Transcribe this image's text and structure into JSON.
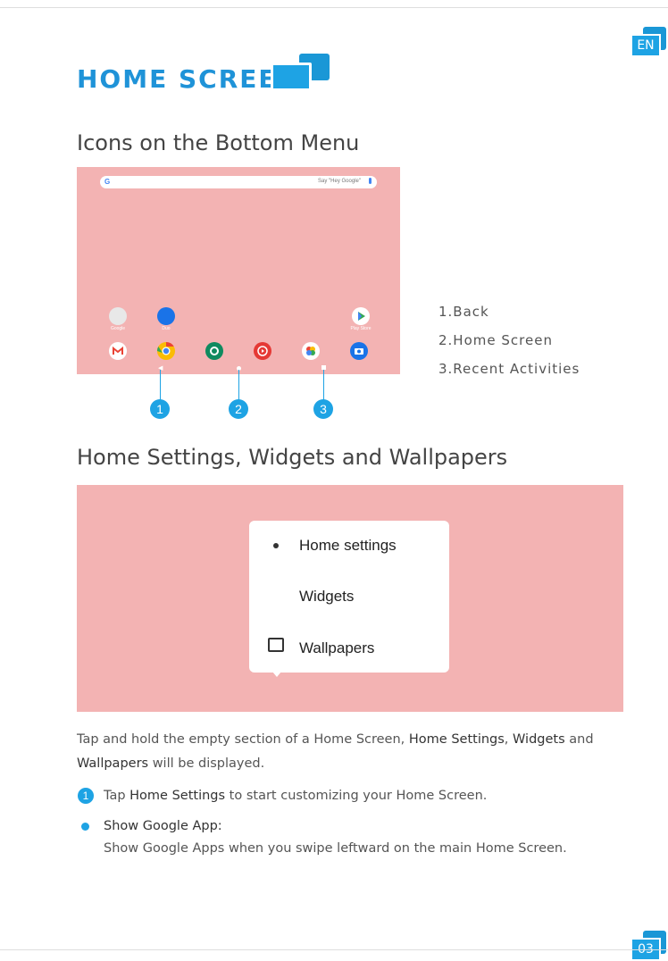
{
  "header": {
    "lang_badge": "EN",
    "title": "HOME SCREEN"
  },
  "section1": {
    "heading": "Icons on the Bottom Menu",
    "screenshot": {
      "search_g": "G",
      "search_hint": "Say \"Hey Google\"",
      "apps_row1": [
        {
          "label": "Google",
          "color": "#e8e8e8"
        },
        {
          "label": "Duo",
          "color": "#1a73e8"
        },
        {
          "label": "Play Store",
          "color": "#ffffff"
        }
      ],
      "apps_row2": [
        {
          "name": "gmail-icon",
          "color": "#ffffff"
        },
        {
          "name": "chrome-icon",
          "color": "#fbbc04"
        },
        {
          "name": "settings-icon",
          "color": "#0f8a5f"
        },
        {
          "name": "youtube-music-icon",
          "color": "#e53935"
        },
        {
          "name": "photos-icon",
          "color": "#ffffff"
        },
        {
          "name": "camera-icon",
          "color": "#1a73e8"
        }
      ]
    },
    "callouts": [
      "1",
      "2",
      "3"
    ],
    "legend": [
      "1.Back",
      "2.Home Screen",
      "3.Recent Activities"
    ]
  },
  "section2": {
    "heading": "Home Settings, Widgets and Wallpapers",
    "menu": [
      "Home settings",
      "Widgets",
      "Wallpapers"
    ]
  },
  "body": {
    "para1_a": "Tap and hold the empty section of a Home Screen, ",
    "para1_home_settings": "Home Settings",
    "para1_comma": ", ",
    "para1_widgets": "Widgets",
    "para1_and": " and",
    "para1_wallpapers": "Wallpapers",
    "para1_end": " will be displayed.",
    "step_num": "1",
    "step_a": "Tap ",
    "step_bold": "Home Settings",
    "step_b": " to start customizing your Home Screen.",
    "bullet_title": "Show Google App:",
    "bullet_text": "Show Google Apps when you swipe leftward on the main Home Screen."
  },
  "footer": {
    "page_number": "03"
  },
  "colors": {
    "accent": "#1ea3e4",
    "screen_bg": "#f3b3b3"
  }
}
